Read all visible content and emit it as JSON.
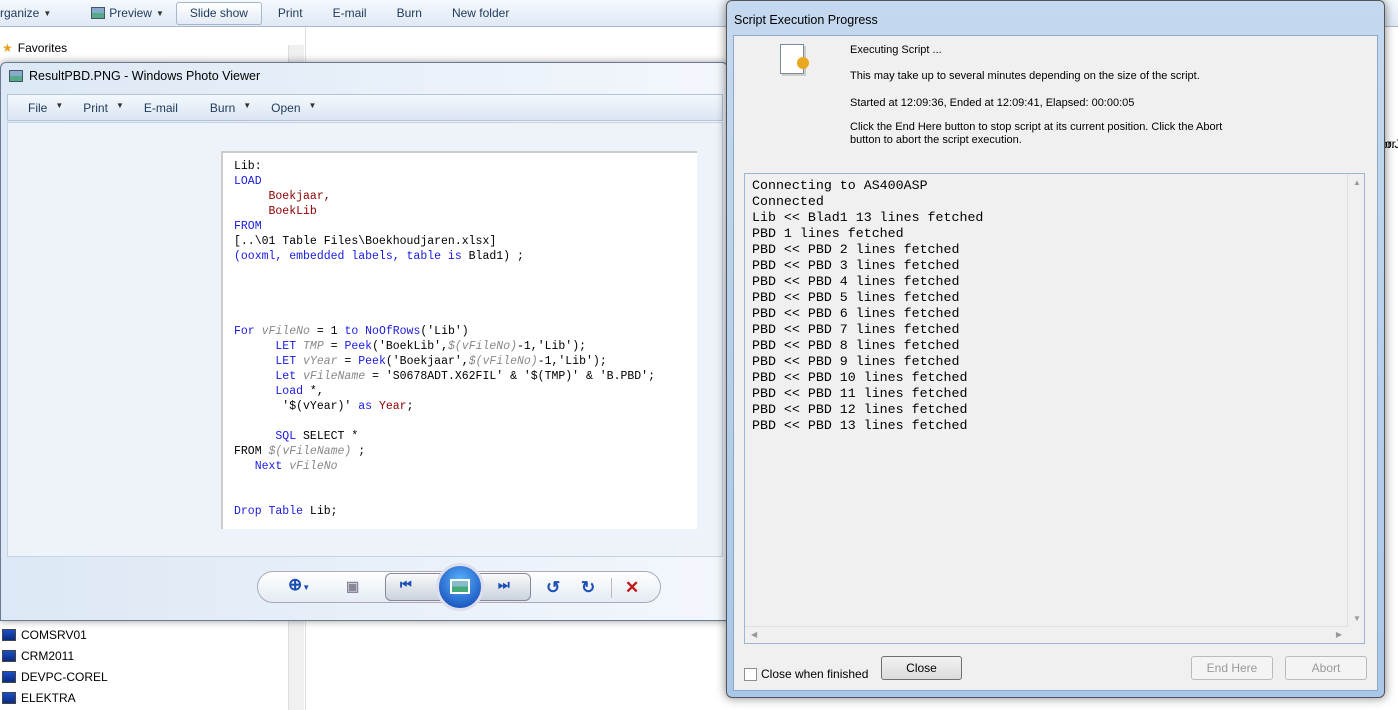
{
  "explorer": {
    "toolbar": [
      {
        "label": "rganize",
        "dropdown": true
      },
      {
        "label": "Preview",
        "dropdown": true
      },
      {
        "label": "Slide show"
      },
      {
        "label": "Print"
      },
      {
        "label": "E-mail"
      },
      {
        "label": "Burn"
      },
      {
        "label": "New folder"
      }
    ],
    "nav": {
      "favorites": "Favorites",
      "computers": [
        "COMSRV01",
        "CRM2011",
        "DEVPC-COREL",
        "ELEKTRA"
      ]
    },
    "content_fragment": "or.J"
  },
  "viewer": {
    "title": "ResultPBD.PNG - Windows Photo Viewer",
    "menu": [
      {
        "label": "File",
        "dropdown": true
      },
      {
        "label": "Print",
        "dropdown": true
      },
      {
        "label": "E-mail",
        "dropdown": false
      },
      {
        "label": "Burn",
        "dropdown": true
      },
      {
        "label": "Open",
        "dropdown": true
      }
    ],
    "code_lines": [
      [
        [
          "Lib:",
          "p"
        ]
      ],
      [
        [
          "LOAD",
          "k"
        ]
      ],
      [
        [
          "     Boekjaar,",
          "f"
        ]
      ],
      [
        [
          "     BoekLib",
          "f"
        ]
      ],
      [
        [
          "FROM",
          "k"
        ]
      ],
      [
        [
          "[..\\01 Table Files\\Boekhoudjaren.xlsx]",
          "p"
        ]
      ],
      [
        [
          "(ooxml, embedded labels, table is ",
          "k"
        ],
        [
          "Blad1) ;",
          "p"
        ]
      ],
      [],
      [],
      [],
      [],
      [
        [
          "For ",
          "k"
        ],
        [
          "vFileNo",
          "v"
        ],
        [
          " = 1 ",
          "p"
        ],
        [
          "to NoOfRows",
          "k"
        ],
        [
          "('Lib')",
          "p"
        ]
      ],
      [
        [
          "      LET ",
          "k"
        ],
        [
          "TMP",
          "v"
        ],
        [
          " = ",
          "p"
        ],
        [
          "Peek",
          "k"
        ],
        [
          "('BoekLib',",
          "p"
        ],
        [
          "$(vFileNo)",
          "v"
        ],
        [
          "-1,'Lib');",
          "p"
        ]
      ],
      [
        [
          "      LET ",
          "k"
        ],
        [
          "vYear",
          "v"
        ],
        [
          " = ",
          "p"
        ],
        [
          "Peek",
          "k"
        ],
        [
          "('Boekjaar',",
          "p"
        ],
        [
          "$(vFileNo)",
          "v"
        ],
        [
          "-1,'Lib');",
          "p"
        ]
      ],
      [
        [
          "      Let ",
          "k"
        ],
        [
          "vFileName",
          "v"
        ],
        [
          " = 'S0678ADT.X62FIL' & '$(TMP)' & 'B.PBD';",
          "p"
        ]
      ],
      [
        [
          "      Load ",
          "k"
        ],
        [
          "*,",
          "p"
        ]
      ],
      [
        [
          "       '$(vYear)' ",
          "p"
        ],
        [
          "as ",
          "k"
        ],
        [
          "Year",
          "f"
        ],
        [
          ";",
          "p"
        ]
      ],
      [],
      [
        [
          "      SQL ",
          "k"
        ],
        [
          "SELECT *",
          "p"
        ]
      ],
      [
        [
          "FROM ",
          "p"
        ],
        [
          "$(vFileName)",
          "v"
        ],
        [
          " ;",
          "p"
        ]
      ],
      [
        [
          "   Next ",
          "k"
        ],
        [
          "vFileNo",
          "v"
        ]
      ],
      [],
      [],
      [
        [
          "Drop Table ",
          "k"
        ],
        [
          "Lib;",
          "p"
        ]
      ]
    ]
  },
  "dialog": {
    "title": "Script Execution Progress",
    "status": "Executing Script ...",
    "note": "This may take up to several minutes depending on the size of the script.",
    "timing": "Started at 12:09:36, Ended at 12:09:41,  Elapsed: 00:00:05",
    "help": "Click the End Here button to stop script at its current position. Click the Abort button to abort the script execution.",
    "log": [
      "Connecting to AS400ASP",
      "Connected",
      "Lib << Blad1 13 lines fetched",
      "PBD 1 lines fetched",
      "PBD << PBD 2 lines fetched",
      "PBD << PBD 3 lines fetched",
      "PBD << PBD 4 lines fetched",
      "PBD << PBD 5 lines fetched",
      "PBD << PBD 6 lines fetched",
      "PBD << PBD 7 lines fetched",
      "PBD << PBD 8 lines fetched",
      "PBD << PBD 9 lines fetched",
      "PBD << PBD 10 lines fetched",
      "PBD << PBD 11 lines fetched",
      "PBD << PBD 12 lines fetched",
      "PBD << PBD 13 lines fetched"
    ],
    "close_when_finished": {
      "label": "Close when finished",
      "checked": false
    },
    "buttons": {
      "close": "Close",
      "end_here": "End Here",
      "abort": "Abort"
    }
  }
}
